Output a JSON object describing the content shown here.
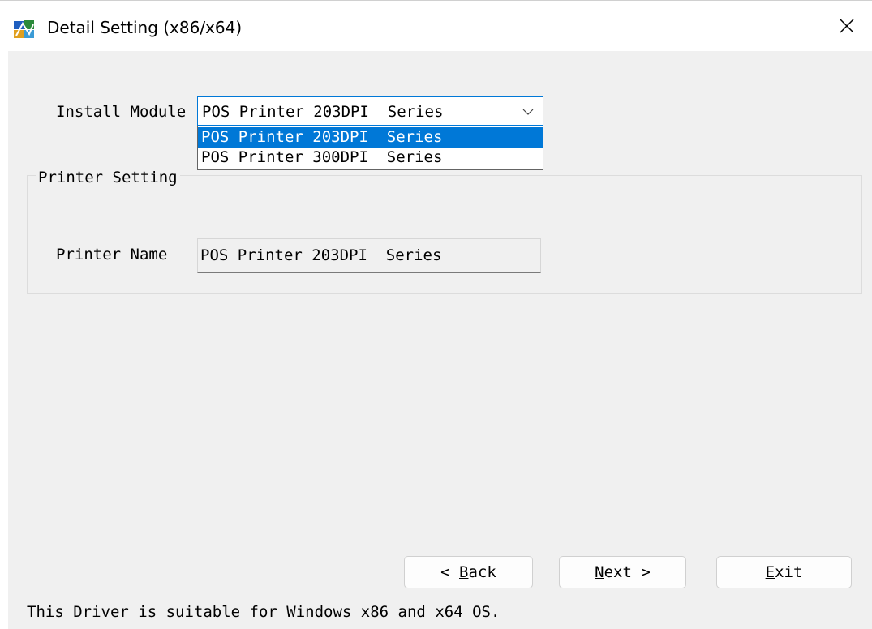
{
  "window": {
    "title": "Detail Setting (x86/x64)",
    "close_glyph": "✕",
    "icon": "installer-app-icon"
  },
  "install_module": {
    "label": "Install Module",
    "selected_value": "POS Printer 203DPI  Series",
    "options": [
      "POS Printer 203DPI  Series",
      "POS Printer 300DPI  Series"
    ],
    "selected_index": 0
  },
  "printer_setting": {
    "group_title": "Printer Setting",
    "name_label": "Printer Name",
    "name_value": "POS Printer 203DPI  Series"
  },
  "buttons": {
    "back": {
      "prefix": "< ",
      "mnemonic": "B",
      "rest": "ack"
    },
    "next": {
      "mnemonic": "N",
      "rest": "ext",
      "suffix": " >"
    },
    "exit": {
      "mnemonic": "E",
      "rest": "xit"
    }
  },
  "footer": "This Driver is suitable for Windows x86 and x64 OS.",
  "colors": {
    "accent": "#0078d7",
    "window_bg": "#f0f0f0"
  }
}
